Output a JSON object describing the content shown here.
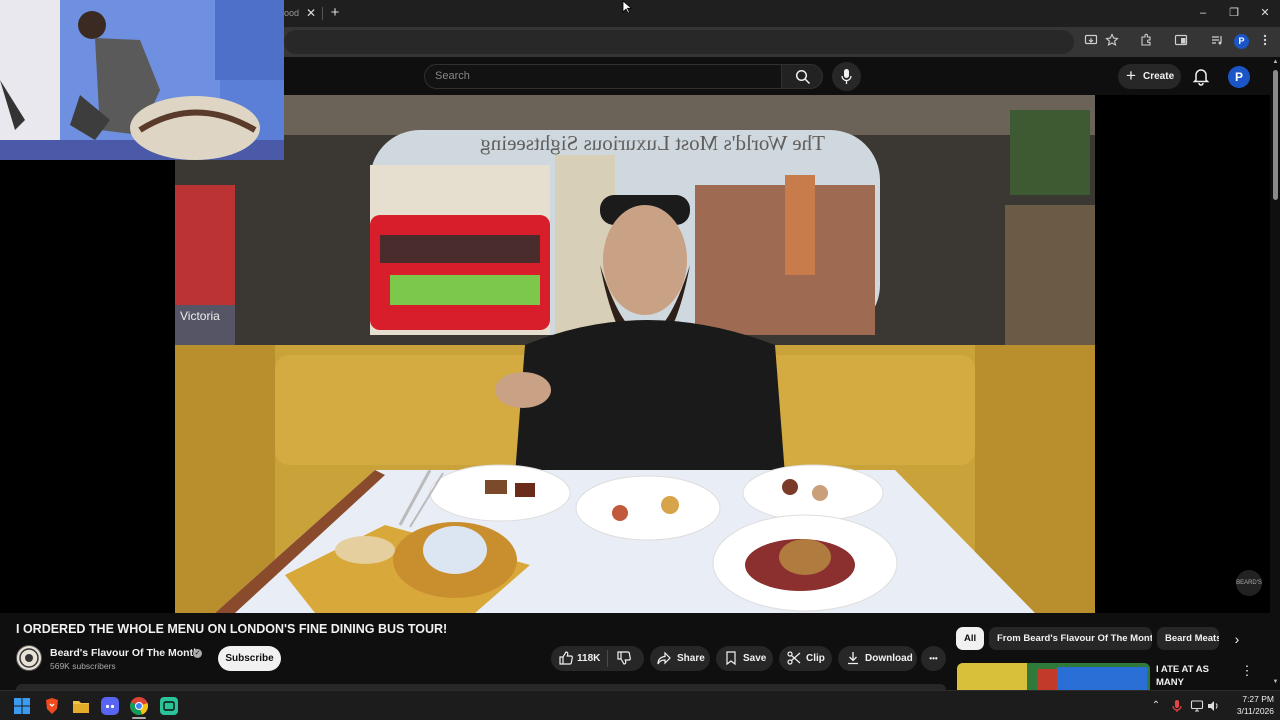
{
  "browser": {
    "tab_title": "ood",
    "tab_close": "✕",
    "new_tab": "+",
    "window_controls": {
      "minimize": "–",
      "restore": "❐",
      "close": "✕"
    },
    "profile_initial": "P"
  },
  "youtube": {
    "search_placeholder": "Search",
    "create_label": "Create",
    "avatar_initial": "P"
  },
  "video": {
    "title": "I ORDERED THE WHOLE MENU ON LONDON'S FINE DINING BUS TOUR!",
    "overlay_sign": "The World's Most Luxurious Sightseeing",
    "bus_sign": "Victoria",
    "watermark": "BEARD'S"
  },
  "channel": {
    "name": "Beard's Flavour Of The Month",
    "subscribers": "569K subscribers",
    "verified_mark": "✓",
    "subscribe_label": "Subscribe"
  },
  "actions": {
    "likes": "118K",
    "share": "Share",
    "save": "Save",
    "clip": "Clip",
    "download": "Download",
    "more": "•••"
  },
  "chips": [
    "All",
    "From Beard's Flavour Of The Month",
    "Beard Meats"
  ],
  "recommendation": {
    "title": "I ATE AT AS MANY CHRISTMAS ...",
    "menu": "⋮"
  },
  "taskbar": {
    "time": "7:27 PM",
    "date": "3/11/2026",
    "tray_chevron": "⌃"
  },
  "colors": {
    "background": "#0f0f0f",
    "pill": "#272727",
    "avatar_blue": "#1a56c8",
    "bus_red": "#d81e2a",
    "seat_yellow": "#c9a23a"
  }
}
